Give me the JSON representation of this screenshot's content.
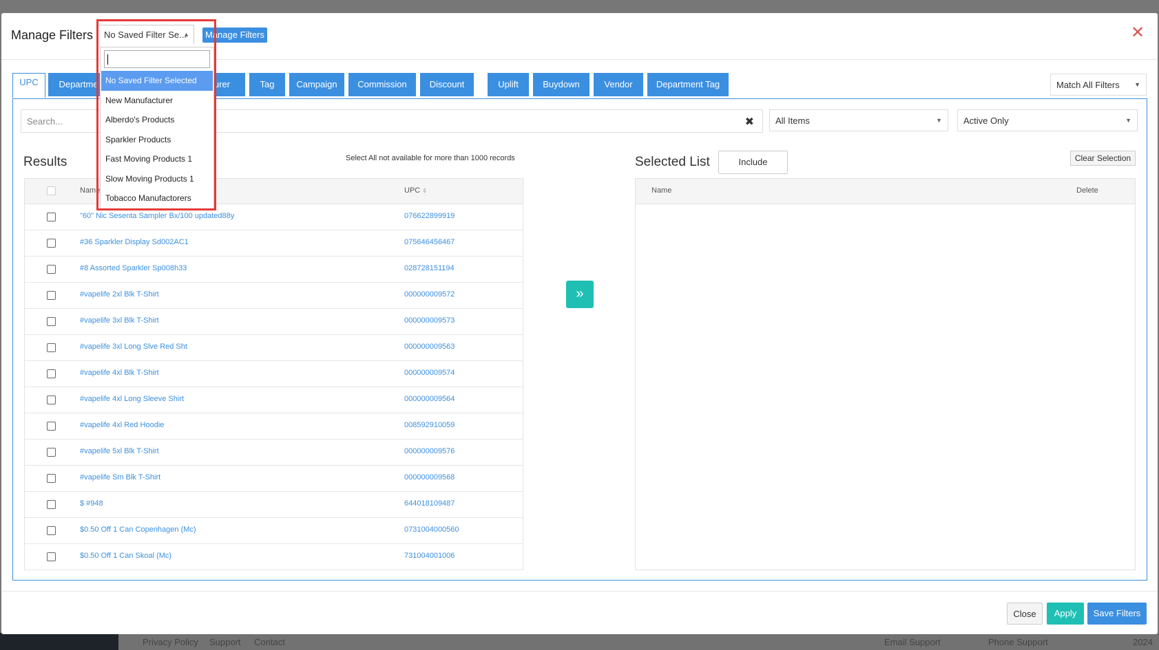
{
  "modal": {
    "title": "Manage Filters",
    "close_icon": "close-icon"
  },
  "saved_filter": {
    "current": "No Saved Filter Se...",
    "manage_label": "Manage Filters",
    "options": [
      "No Saved Filter Selected",
      "New Manufacturer",
      "Alberdo's Products",
      "Sparkler Products",
      "Fast Moving Products 1",
      "Slow Moving Products 1",
      "Tobacco Manufactorers"
    ]
  },
  "tabs": [
    {
      "label": "UPC"
    },
    {
      "label": "Departme"
    },
    {
      "label": "cturer"
    },
    {
      "label": "Tag"
    },
    {
      "label": "Campaign"
    },
    {
      "label": "Commission"
    },
    {
      "label": "Discount"
    },
    {
      "label": "Uplift"
    },
    {
      "label": "Buydown"
    },
    {
      "label": "Vendor"
    },
    {
      "label": "Department Tag"
    }
  ],
  "match_filter": "Match All Filters",
  "search": {
    "placeholder": "Search..."
  },
  "items_filter": "All Items",
  "status_filter": "Active Only",
  "results": {
    "title": "Results",
    "note": "Select All not available for more than 1000 records",
    "col_name": "Name",
    "col_upc": "UPC",
    "rows": [
      {
        "name": "\"60\" Nic Sesenta Sampler Bx/100 updated88y",
        "upc": "076622899919"
      },
      {
        "name": "#36 Sparkler Display Sd002AC1",
        "upc": "075646456467"
      },
      {
        "name": "#8 Assorted Sparkler Sp008h33",
        "upc": "028728151194"
      },
      {
        "name": "#vapelife 2xl Blk T-Shirt",
        "upc": "000000009572"
      },
      {
        "name": "#vapelife 3xl Blk T-Shirt",
        "upc": "000000009573"
      },
      {
        "name": "#vapelife 3xl Long Slve Red Sht",
        "upc": "000000009563"
      },
      {
        "name": "#vapelife 4xl Blk T-Shirt",
        "upc": "000000009574"
      },
      {
        "name": "#vapelife 4xl Long Sleeve Shirt",
        "upc": "000000009564"
      },
      {
        "name": "#vapelife 4xl Red Hoodie",
        "upc": "008592910059"
      },
      {
        "name": "#vapelife 5xl Blk T-Shirt",
        "upc": "000000009576"
      },
      {
        "name": "#vapelife Sm Blk T-Shirt",
        "upc": "000000009568"
      },
      {
        "name": "$ #948",
        "upc": "644018109487"
      },
      {
        "name": "$0.50 Off 1 Can Copenhagen (Mc)",
        "upc": "0731004000560"
      },
      {
        "name": "$0.50 Off 1 Can Skoal (Mc)",
        "upc": "731004001006"
      }
    ]
  },
  "selected": {
    "title": "Selected List",
    "include_label": "Include",
    "clear_label": "Clear Selection",
    "col_name": "Name",
    "col_delete": "Delete"
  },
  "footer": {
    "close_label": "Close",
    "apply_label": "Apply",
    "save_label": "Save Filters"
  },
  "background_footer": {
    "privacy": "Privacy Policy",
    "support": "Support",
    "contact": "Contact",
    "email_support": "Email Support",
    "phone_support": "Phone Support",
    "year": "2024"
  },
  "colors": {
    "accent": "#3b8fe0",
    "teal": "#1fbfb4",
    "highlight": "#e53935",
    "close": "#d9534f"
  }
}
